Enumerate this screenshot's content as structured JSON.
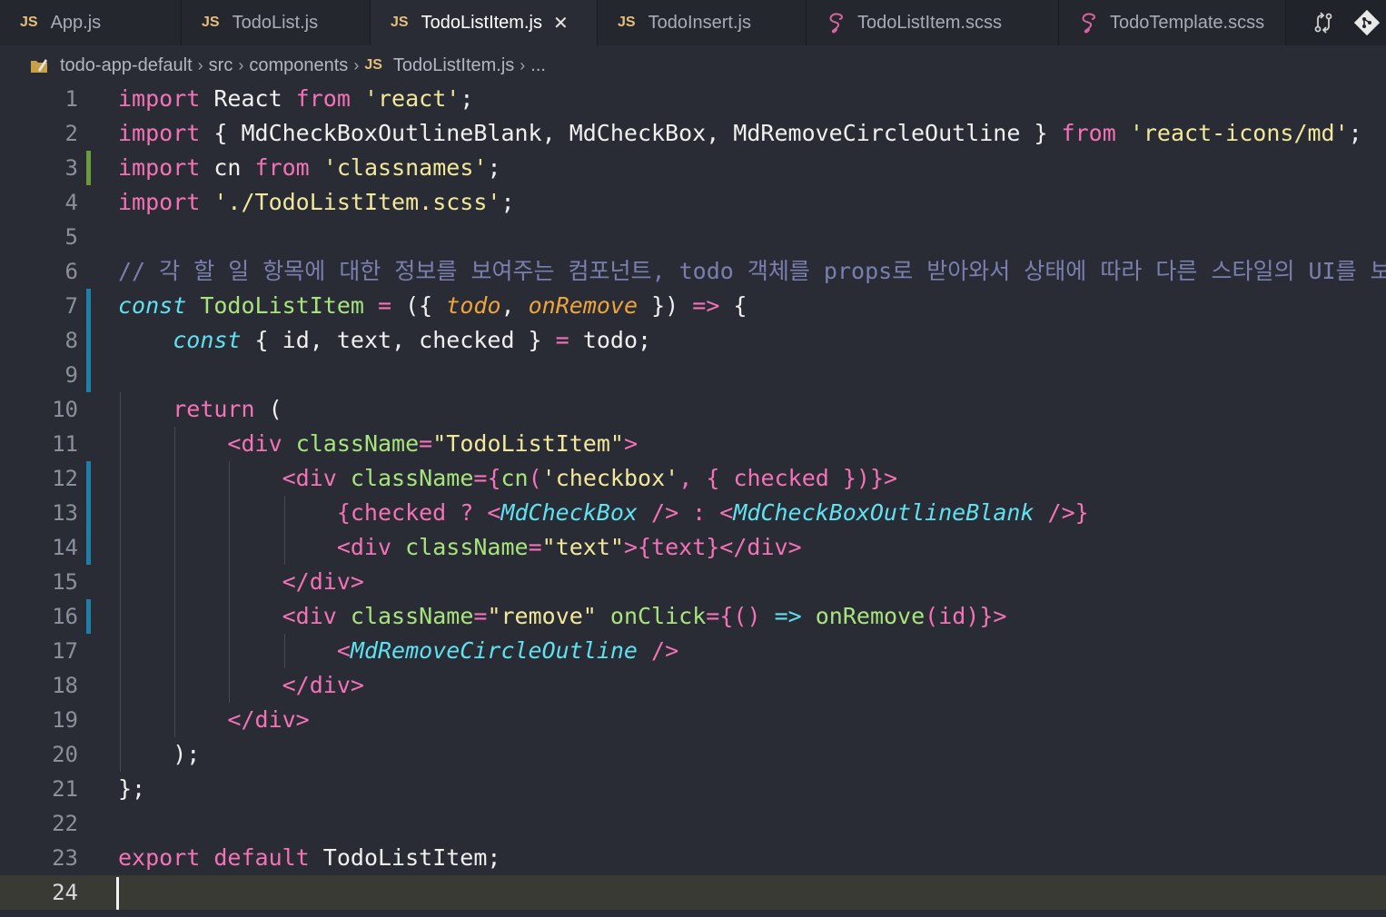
{
  "tabs": [
    {
      "label": "App.js",
      "type": "js",
      "active": false
    },
    {
      "label": "TodoList.js",
      "type": "js",
      "active": false
    },
    {
      "label": "TodoListItem.js",
      "type": "js",
      "active": true
    },
    {
      "label": "TodoInsert.js",
      "type": "js",
      "active": false
    },
    {
      "label": "TodoListItem.scss",
      "type": "scss",
      "active": false
    },
    {
      "label": "TodoTemplate.scss",
      "type": "scss",
      "active": false
    }
  ],
  "tab_js_badge": "JS",
  "breadcrumb": {
    "items": [
      "todo-app-default",
      "src",
      "components",
      "TodoListItem.js",
      "..."
    ]
  },
  "editor": {
    "current_line": 24,
    "lines": [
      {
        "n": "1",
        "tokens": [
          [
            "kw",
            "import"
          ],
          [
            "plain",
            " React "
          ],
          [
            "kw",
            "from"
          ],
          [
            "plain",
            " "
          ],
          [
            "str",
            "'react'"
          ],
          [
            "plain",
            ";"
          ]
        ]
      },
      {
        "n": "2",
        "tokens": [
          [
            "kw",
            "import"
          ],
          [
            "plain",
            " { MdCheckBoxOutlineBlank, MdCheckBox, MdRemoveCircleOutline } "
          ],
          [
            "kw",
            "from"
          ],
          [
            "plain",
            " "
          ],
          [
            "str",
            "'react-icons/md'"
          ],
          [
            "plain",
            ";"
          ]
        ]
      },
      {
        "n": "3",
        "tokens": [
          [
            "kw",
            "import"
          ],
          [
            "plain",
            " cn "
          ],
          [
            "kw",
            "from"
          ],
          [
            "plain",
            " "
          ],
          [
            "str",
            "'classnames'"
          ],
          [
            "plain",
            ";"
          ]
        ]
      },
      {
        "n": "4",
        "tokens": [
          [
            "kw",
            "import"
          ],
          [
            "plain",
            " "
          ],
          [
            "str",
            "'./TodoListItem.scss'"
          ],
          [
            "plain",
            ";"
          ]
        ]
      },
      {
        "n": "5",
        "tokens": []
      },
      {
        "n": "6",
        "tokens": [
          [
            "com",
            "// 각 할 일 항목에 대한 정보를 보여주는 컴포넌트, todo 객체를 props로 받아와서 상태에 따라 다른 스타일의 UI를 보여줌"
          ]
        ]
      },
      {
        "n": "7",
        "tokens": [
          [
            "kw2",
            "const"
          ],
          [
            "plain",
            " "
          ],
          [
            "fn",
            "TodoListItem"
          ],
          [
            "plain",
            " "
          ],
          [
            "op",
            "="
          ],
          [
            "plain",
            " ({ "
          ],
          [
            "param",
            "todo"
          ],
          [
            "plain",
            ", "
          ],
          [
            "param",
            "onRemove"
          ],
          [
            "plain",
            " }) "
          ],
          [
            "op",
            "=>"
          ],
          [
            "plain",
            " {"
          ]
        ]
      },
      {
        "n": "8",
        "tokens": [
          [
            "plain",
            "    "
          ],
          [
            "kw2",
            "const"
          ],
          [
            "plain",
            " { id, text, checked } "
          ],
          [
            "op",
            "="
          ],
          [
            "plain",
            " todo;"
          ]
        ]
      },
      {
        "n": "9",
        "tokens": []
      },
      {
        "n": "10",
        "tokens": [
          [
            "plain",
            "    "
          ],
          [
            "kw",
            "return"
          ],
          [
            "plain",
            " ("
          ]
        ]
      },
      {
        "n": "11",
        "tokens": [
          [
            "plain",
            "        "
          ],
          [
            "tag",
            "<div"
          ],
          [
            "plain",
            " "
          ],
          [
            "attr",
            "className"
          ],
          [
            "op",
            "="
          ],
          [
            "str",
            "\"TodoListItem\""
          ],
          [
            "tag",
            ">"
          ]
        ]
      },
      {
        "n": "12",
        "tokens": [
          [
            "plain",
            "            "
          ],
          [
            "tag",
            "<div"
          ],
          [
            "plain",
            " "
          ],
          [
            "attr",
            "className"
          ],
          [
            "op",
            "="
          ],
          [
            "tag",
            "{"
          ],
          [
            "fn",
            "cn"
          ],
          [
            "tag",
            "("
          ],
          [
            "str",
            "'checkbox'"
          ],
          [
            "tag",
            ","
          ],
          [
            "plain",
            " "
          ],
          [
            "tag",
            "{"
          ],
          [
            "plain",
            " "
          ],
          [
            "tag",
            "checked"
          ],
          [
            "plain",
            " "
          ],
          [
            "tag",
            "})}"
          ],
          [
            "tag",
            ">"
          ]
        ]
      },
      {
        "n": "13",
        "tokens": [
          [
            "plain",
            "                "
          ],
          [
            "tag",
            "{checked ? <"
          ],
          [
            "comp",
            "MdCheckBox"
          ],
          [
            "plain",
            " "
          ],
          [
            "tag",
            "/> : <"
          ],
          [
            "comp",
            "MdCheckBoxOutlineBlank"
          ],
          [
            "plain",
            " "
          ],
          [
            "tag",
            "/>}"
          ]
        ]
      },
      {
        "n": "14",
        "tokens": [
          [
            "plain",
            "                "
          ],
          [
            "tag",
            "<div"
          ],
          [
            "plain",
            " "
          ],
          [
            "attr",
            "className"
          ],
          [
            "op",
            "="
          ],
          [
            "str",
            "\"text\""
          ],
          [
            "tag",
            ">{text}</div>"
          ]
        ]
      },
      {
        "n": "15",
        "tokens": [
          [
            "plain",
            "            "
          ],
          [
            "tag",
            "</div>"
          ]
        ]
      },
      {
        "n": "16",
        "tokens": [
          [
            "plain",
            "            "
          ],
          [
            "tag",
            "<div"
          ],
          [
            "plain",
            " "
          ],
          [
            "attr",
            "className"
          ],
          [
            "op",
            "="
          ],
          [
            "str",
            "\"remove\""
          ],
          [
            "plain",
            " "
          ],
          [
            "attr",
            "onClick"
          ],
          [
            "op",
            "="
          ],
          [
            "tag",
            "{()"
          ],
          [
            "plain",
            " "
          ],
          [
            "kw2",
            "=>"
          ],
          [
            "plain",
            " "
          ],
          [
            "fn",
            "onRemove"
          ],
          [
            "tag",
            "(id)}"
          ],
          [
            "tag",
            ">"
          ]
        ]
      },
      {
        "n": "17",
        "tokens": [
          [
            "plain",
            "                "
          ],
          [
            "tag",
            "<"
          ],
          [
            "comp",
            "MdRemoveCircleOutline"
          ],
          [
            "plain",
            " "
          ],
          [
            "tag",
            "/>"
          ]
        ]
      },
      {
        "n": "18",
        "tokens": [
          [
            "plain",
            "            "
          ],
          [
            "tag",
            "</div>"
          ]
        ]
      },
      {
        "n": "19",
        "tokens": [
          [
            "plain",
            "        "
          ],
          [
            "tag",
            "</div>"
          ]
        ]
      },
      {
        "n": "20",
        "tokens": [
          [
            "plain",
            "    );"
          ]
        ]
      },
      {
        "n": "21",
        "tokens": [
          [
            "plain",
            "};"
          ]
        ]
      },
      {
        "n": "22",
        "tokens": []
      },
      {
        "n": "23",
        "tokens": [
          [
            "kw",
            "export"
          ],
          [
            "plain",
            " "
          ],
          [
            "kw",
            "default"
          ],
          [
            "plain",
            " TodoListItem;"
          ]
        ]
      },
      {
        "n": "24",
        "tokens": []
      }
    ],
    "change_marks": [
      {
        "line": 3,
        "color": "#6a9a3a"
      },
      {
        "line": 7,
        "color": "#1f7fa8"
      },
      {
        "line": 8,
        "color": "#1f7fa8"
      },
      {
        "line": 9,
        "color": "#1f7fa8"
      },
      {
        "line": 12,
        "color": "#1f7fa8"
      },
      {
        "line": 13,
        "color": "#1f7fa8"
      },
      {
        "line": 14,
        "color": "#1f7fa8"
      },
      {
        "line": 16,
        "color": "#1f7fa8"
      }
    ]
  },
  "colors": {
    "background": "#2a2c35",
    "keyword": "#f472b6",
    "string": "#f1e89a",
    "function": "#a8e47c",
    "comment": "#7a7fae",
    "param": "#f0a43c",
    "component": "#5fe1f0"
  },
  "icons": {
    "compare": "compare-changes-icon",
    "git": "git-icon",
    "folder": "folder-icon",
    "sass": "sass-icon",
    "close": "close-icon"
  }
}
